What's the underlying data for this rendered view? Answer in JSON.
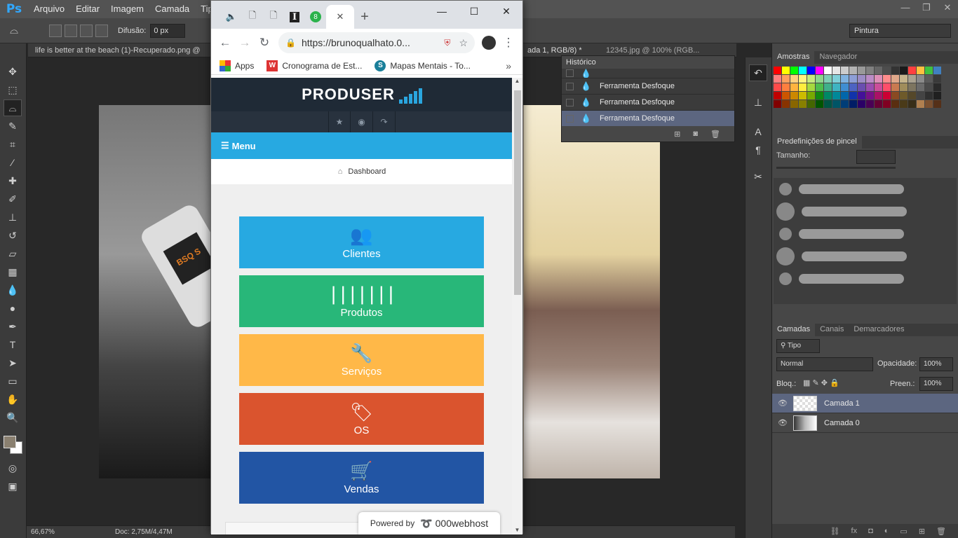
{
  "ps": {
    "logo": "Ps",
    "menu": [
      "Arquivo",
      "Editar",
      "Imagem",
      "Camada",
      "Tipo"
    ],
    "options": {
      "feather_label": "Difusão:",
      "feather_value": "0 px",
      "workspace": "Pintura"
    },
    "tabs": [
      "life is better at the beach (1)-Recuperado.png @",
      "ada 1, RGB/8) *",
      "12345.jpg @ 100% (RGB..."
    ],
    "status": {
      "zoom": "66,67%",
      "doc": "Doc: 2,75M/4,47M"
    },
    "history": {
      "title": "Histórico",
      "rows": [
        "Ferramenta Desfoque",
        "Ferramenta Desfoque",
        "Ferramenta Desfoque"
      ]
    },
    "panels": {
      "swatches_tab": "Amostras",
      "navigator_tab": "Navegador",
      "brush_title": "Predefinições de pincel",
      "brush_size_label": "Tamanho:",
      "layers_tabs": [
        "Camadas",
        "Canais",
        "Demarcadores"
      ],
      "layer_filter": "Tipo",
      "blend_mode": "Normal",
      "opacity_label": "Opacidade:",
      "opacity": "100%",
      "lock_label": "Bloq.:",
      "fill_label": "Preen.:",
      "fill": "100%",
      "layers": [
        "Camada 1",
        "Camada 0"
      ]
    },
    "phone_text": "BSQ S"
  },
  "swatch_colors": [
    "#ff0000",
    "#ffff00",
    "#00ff00",
    "#00ffff",
    "#0000ff",
    "#ff00ff",
    "#ffffff",
    "#e6e6e6",
    "#cccccc",
    "#b3b3b3",
    "#999999",
    "#808080",
    "#666666",
    "#4d4d4d",
    "#333333",
    "#1a1a1a",
    "#ff4040",
    "#ffc040",
    "#40c040",
    "#4080c0",
    "#ff8080",
    "#ff9f5f",
    "#ffd17f",
    "#fff380",
    "#c7e97e",
    "#8fd58e",
    "#7fcfb4",
    "#7fd0d9",
    "#7fb2e0",
    "#8d9ed6",
    "#9c8cc6",
    "#bb8cc6",
    "#de8fb8",
    "#ff8c8c",
    "#e0a88a",
    "#c5b48c",
    "#a9a18f",
    "#8a8a8a",
    "#5a5a5a",
    "#3a3a3a",
    "#ff4a4a",
    "#ff7f3f",
    "#ffb43f",
    "#ffed3f",
    "#a6d93f",
    "#4ebd4e",
    "#3fb08a",
    "#3fb4c2",
    "#3f8ed2",
    "#4d63c2",
    "#6a4eb0",
    "#9a4eb0",
    "#cc4e9a",
    "#ff4e6a",
    "#c97a50",
    "#a08d5c",
    "#7d7560",
    "#6a6a6a",
    "#4a4a4a",
    "#2a2a2a",
    "#c00000",
    "#cc5500",
    "#cc8800",
    "#ccbb00",
    "#77aa00",
    "#118811",
    "#008866",
    "#008899",
    "#0066aa",
    "#1133aa",
    "#441199",
    "#771188",
    "#aa1166",
    "#cc0033",
    "#8a4a22",
    "#6e5a2a",
    "#55482a",
    "#444444",
    "#303030",
    "#202020",
    "#800000",
    "#883300",
    "#886600",
    "#888000",
    "#446600",
    "#005500",
    "#005544",
    "#005566",
    "#003d77",
    "#001d66",
    "#2a0066",
    "#4a0055",
    "#660033",
    "#800022",
    "#5a2e10",
    "#4a3a18",
    "#382e18",
    "#b08050",
    "#7a5030",
    "#553018"
  ],
  "chrome": {
    "url": "https://brunoqualhato.0...",
    "bookmarks": [
      "Apps",
      "Cronograma de Est...",
      "Mapas Mentais - To..."
    ],
    "badge": "8"
  },
  "site": {
    "logo": "PRODUSER",
    "menu": "Menu",
    "breadcrumb": "Dashboard",
    "tiles": [
      {
        "label": "Clientes",
        "color": "#27a9e1",
        "icon": "users-icon"
      },
      {
        "label": "Produtos",
        "color": "#28b779",
        "icon": "barcode-icon"
      },
      {
        "label": "Serviços",
        "color": "#ffb848",
        "icon": "wrench-icon"
      },
      {
        "label": "OS",
        "color": "#da542e",
        "icon": "tags-icon"
      },
      {
        "label": "Vendas",
        "color": "#2255a4",
        "icon": "cart-icon"
      }
    ],
    "powered_by": "Powered by",
    "host": "000webhost"
  }
}
